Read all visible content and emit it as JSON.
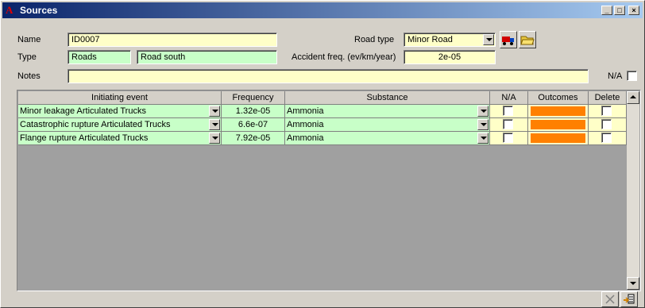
{
  "window": {
    "title": "Sources",
    "app_icon": "app-logo-icon"
  },
  "titlebar_buttons": {
    "minimize": "_",
    "maximize": "□",
    "close": "×"
  },
  "form": {
    "name_label": "Name",
    "name_value": "ID0007",
    "type_label": "Type",
    "type_value": "Roads",
    "type_detail": "Road south",
    "notes_label": "Notes",
    "notes_value": "",
    "road_type_label": "Road type",
    "road_type_value": "Minor Road",
    "accident_freq_label": "Accident freq. (ev/km/year)",
    "accident_freq_value": "2e-05",
    "na_label": "N/A"
  },
  "grid": {
    "columns": [
      "Initiating event",
      "Frequency",
      "Substance",
      "N/A",
      "Outcomes",
      "Delete"
    ],
    "rows": [
      {
        "event": "Minor leakage Articulated Trucks",
        "frequency": "1.32e-05",
        "substance": "Ammonia"
      },
      {
        "event": "Catastrophic rupture Articulated Trucks",
        "frequency": "6.6e-07",
        "substance": "Ammonia"
      },
      {
        "event": "Flange rupture Articulated Trucks",
        "frequency": "7.92e-05",
        "substance": "Ammonia"
      }
    ]
  },
  "colors": {
    "field_yellow": "#ffffc8",
    "field_green": "#c8ffc8",
    "outcome_orange": "#ff8000"
  }
}
